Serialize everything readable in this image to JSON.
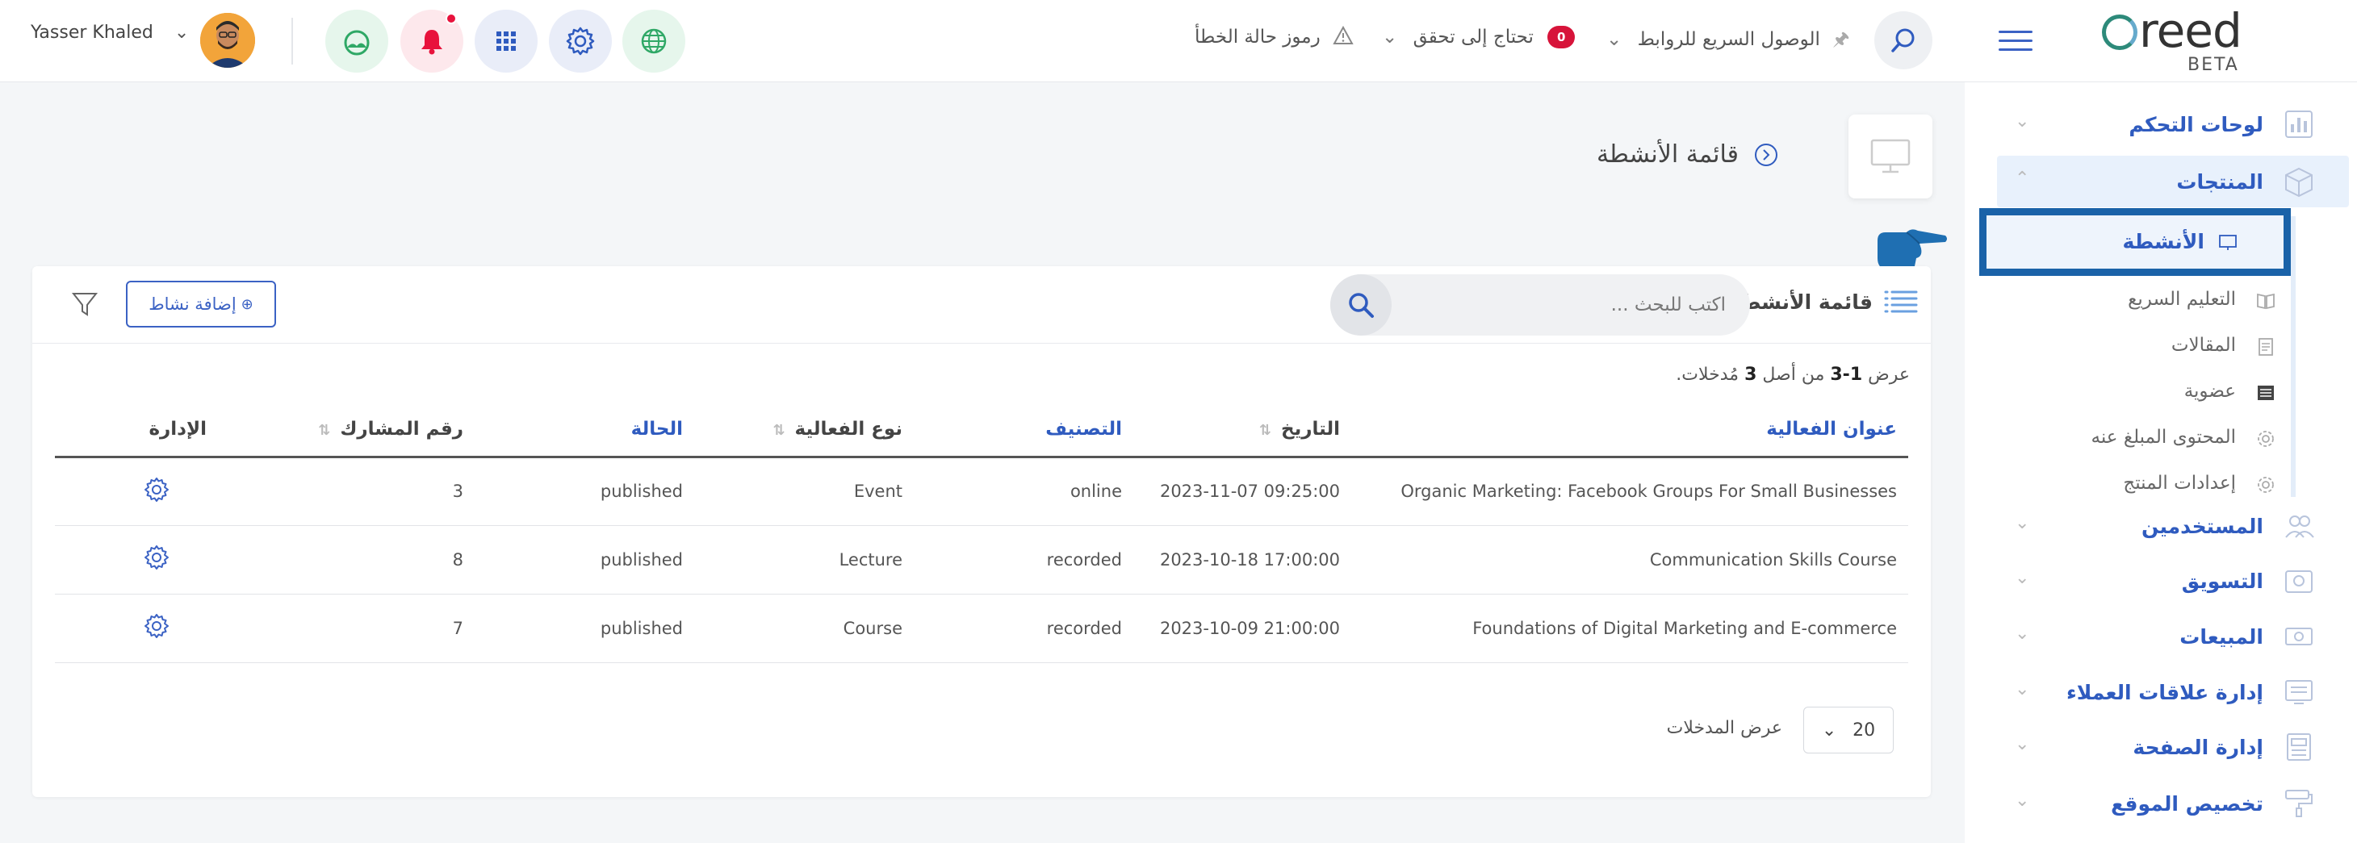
{
  "header": {
    "user_name": "Yasser Khaled",
    "links": {
      "error_codes": "رموز حالة الخطأ",
      "needs_verify": "تحتاج إلى تحقق",
      "needs_verify_count": "0",
      "quick_links": "الوصول السريع للروابط"
    },
    "icons": [
      "language-icon",
      "settings-icon",
      "apps-grid-icon",
      "notification-bell-icon",
      "weather-icon"
    ],
    "logo": {
      "text": "reed",
      "beta": "BETA"
    }
  },
  "sidebar": {
    "items": [
      {
        "label": "لوحات التحكم"
      },
      {
        "label": "المنتجات"
      },
      {
        "label": "المستخدمين"
      },
      {
        "label": "التسويق"
      },
      {
        "label": "المبيعات"
      },
      {
        "label": "إدارة علاقات العملاء"
      },
      {
        "label": "إدارة الصفحة"
      },
      {
        "label": "تخصيص الموقع"
      }
    ],
    "sub_items": [
      {
        "label": "الأنشطة"
      },
      {
        "label": "التعليم السريع"
      },
      {
        "label": "المقالات"
      },
      {
        "label": "عضوية"
      },
      {
        "label": "المحتوى المبلغ عنه"
      },
      {
        "label": "إعدادات المنتج"
      }
    ]
  },
  "page": {
    "title": "قائمة الأنشطة"
  },
  "card": {
    "list_title": "قائمة الأنشطة",
    "search_placeholder": "اكتب للبحث ...",
    "add_button": "إضافة نشاط",
    "entries_info": {
      "prefix": "عرض",
      "range": "1-3",
      "middle": "من أصل",
      "total": "3",
      "suffix": "مُدخلات."
    },
    "columns": {
      "title": "عنوان الفعالية",
      "date": "التاريخ",
      "category": "التصنيف",
      "type": "نوع الفعالية",
      "status": "الحالة",
      "participant": "رقم المشارك",
      "manage": "الإدارة"
    },
    "rows": [
      {
        "title": "Organic Marketing: Facebook Groups For Small Businesses",
        "date": "2023-11-07 09:25:00",
        "category": "online",
        "type": "Event",
        "status": "published",
        "participant": "3"
      },
      {
        "title": "Communication Skills Course",
        "date": "2023-10-18 17:00:00",
        "category": "recorded",
        "type": "Lecture",
        "status": "published",
        "participant": "8"
      },
      {
        "title": "Foundations of Digital Marketing and E-commerce",
        "date": "2023-10-09 21:00:00",
        "category": "recorded",
        "type": "Course",
        "status": "published",
        "participant": "7"
      }
    ],
    "per_page_value": "20",
    "per_page_label": "عرض المدخلات"
  },
  "colors": {
    "accent": "#2f5bbf",
    "highlight_border": "#1a62a8",
    "badge": "#d7143a"
  }
}
